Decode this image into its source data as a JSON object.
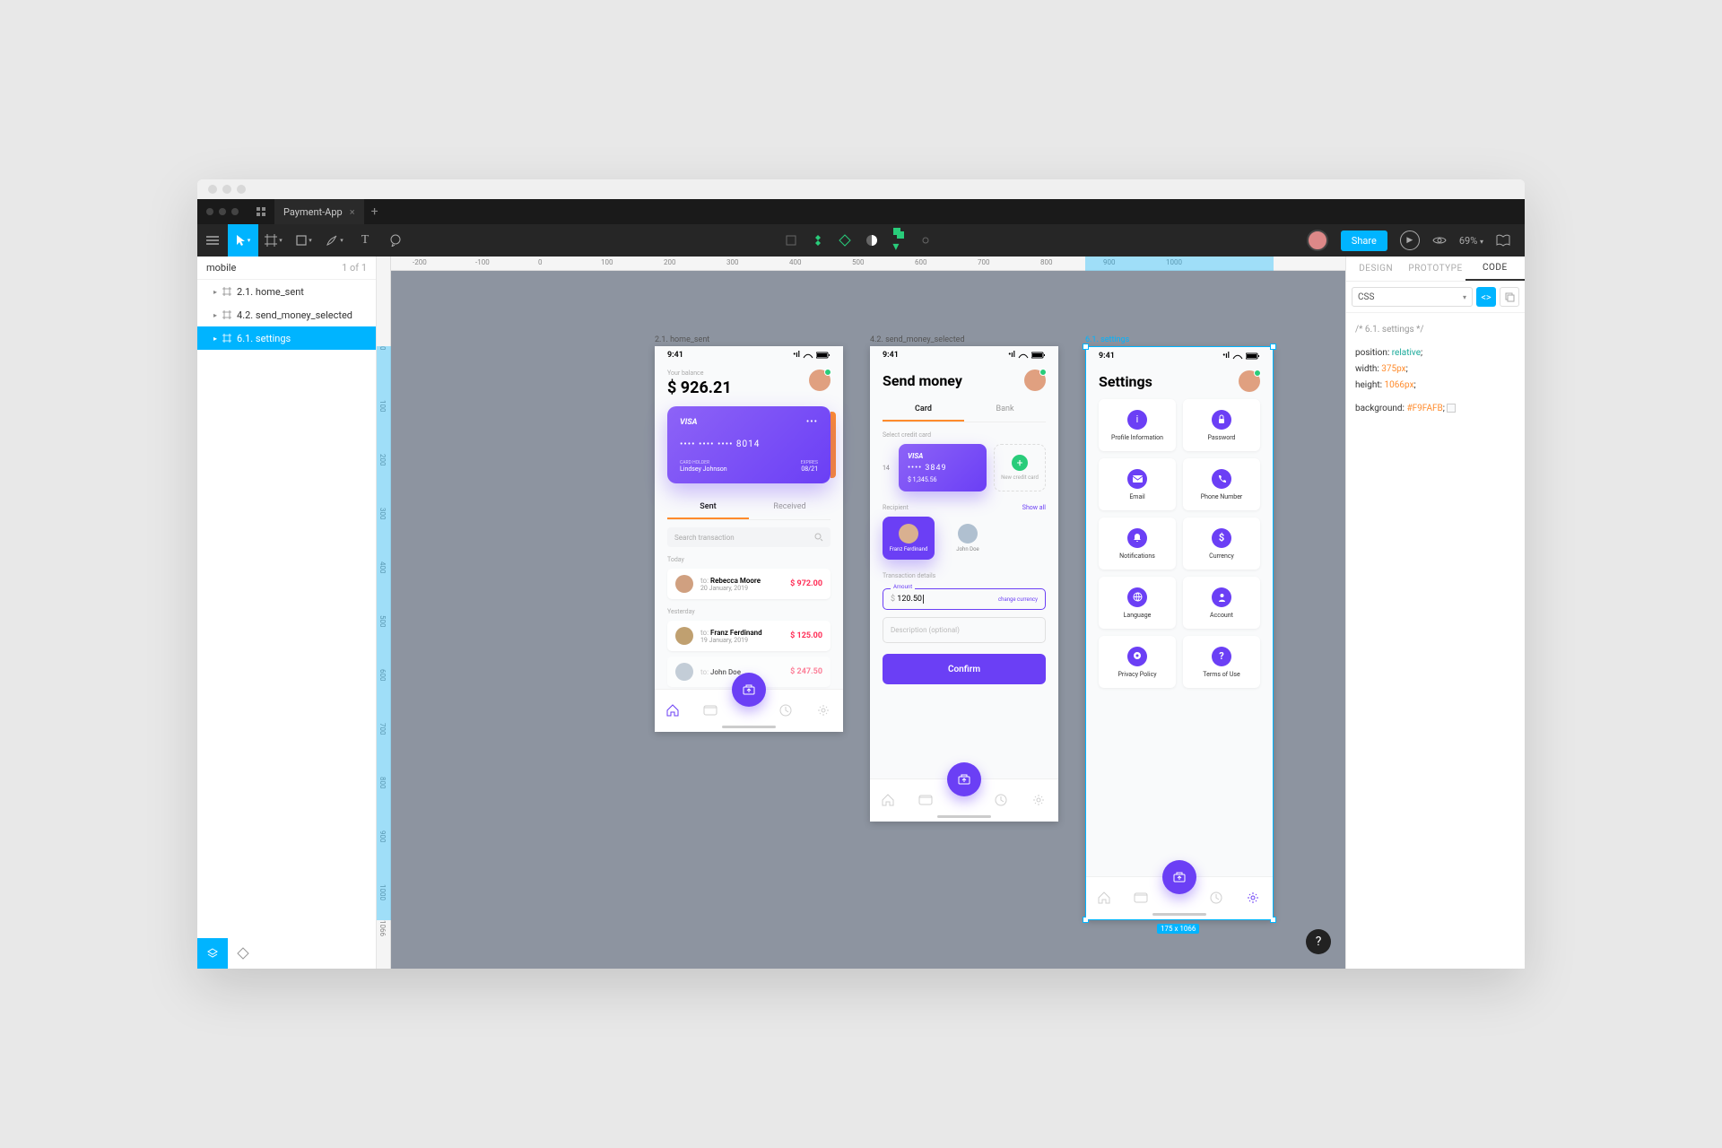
{
  "app": {
    "tab_title": "Payment-App",
    "share_label": "Share",
    "zoom_label": "69%"
  },
  "left_panel": {
    "page_label": "mobile",
    "page_count": "1 of 1",
    "layers": [
      {
        "label": "2.1. home_sent"
      },
      {
        "label": "4.2. send_money_selected"
      },
      {
        "label": "6.1. settings"
      }
    ]
  },
  "ruler_h": [
    "-200",
    "-100",
    "0",
    "100",
    "200",
    "300",
    "400",
    "500",
    "600",
    "700",
    "800",
    "900",
    "1000"
  ],
  "ruler_v": [
    "0",
    "100",
    "200",
    "300",
    "400",
    "500",
    "600",
    "700",
    "800",
    "900",
    "1000",
    "1066"
  ],
  "artboards": {
    "home": {
      "label": "2.1. home_sent",
      "time": "9:41",
      "balance_label": "Your balance",
      "balance_value": "$ 926.21",
      "card": {
        "brand": "VISA",
        "number": "•••• •••• •••• 8014",
        "holder_lbl": "CARD HOLDER",
        "holder": "Lindsey Johnson",
        "exp_lbl": "EXPIRES",
        "exp": "08/21"
      },
      "tabs": {
        "sent": "Sent",
        "received": "Received"
      },
      "search_placeholder": "Search transaction",
      "today": "Today",
      "yesterday": "Yesterday",
      "txns": [
        {
          "to": "to:",
          "name": "Rebecca Moore",
          "date": "20 January, 2019",
          "amount": "$ 972.00"
        },
        {
          "to": "to:",
          "name": "Franz Ferdinand",
          "date": "19 January, 2019",
          "amount": "$ 125.00"
        },
        {
          "to": "to:",
          "name": "John Doe",
          "date": "",
          "amount": "$ 247.50"
        }
      ]
    },
    "send": {
      "label": "4.2. send_money_selected",
      "time": "9:41",
      "title": "Send money",
      "tabs": {
        "card": "Card",
        "bank": "Bank"
      },
      "select_card_lbl": "Select credit card",
      "card": {
        "brand": "VISA",
        "number": "•••• 3849",
        "balance": "$ 1,345.56"
      },
      "new_card": "New credit card",
      "peek_num": "14",
      "recipient_lbl": "Recipient",
      "show_all": "Show all",
      "recipients": [
        {
          "name": "Franz Ferdinand"
        },
        {
          "name": "John Doe"
        }
      ],
      "txn_details_lbl": "Transaction details",
      "amount_lbl": "Amount",
      "amount_prefix": "$",
      "amount_value": "120.50",
      "change_currency": "change currency",
      "description_placeholder": "Description (optional)",
      "confirm": "Confirm"
    },
    "settings": {
      "label": "6.1. settings",
      "time": "9:41",
      "title": "Settings",
      "tiles": [
        "Profile Information",
        "Password",
        "Email",
        "Phone Number",
        "Notifications",
        "Currency",
        "Language",
        "Account",
        "Privacy Policy",
        "Terms of Use"
      ],
      "selection_dim": "175 x 1066"
    }
  },
  "right_panel": {
    "tabs": {
      "design": "DESIGN",
      "prototype": "PROTOTYPE",
      "code": "CODE"
    },
    "lang": "CSS",
    "code": {
      "comment": "/* 6.1. settings */",
      "l1a": "position:",
      "l1b": "relative",
      "l1c": ";",
      "l2a": "width:",
      "l2b": "375px",
      "l2c": ";",
      "l3a": "height:",
      "l3b": "1066px",
      "l3c": ";",
      "l4a": "background:",
      "l4b": "#F9FAFB",
      "l4c": ";"
    }
  }
}
